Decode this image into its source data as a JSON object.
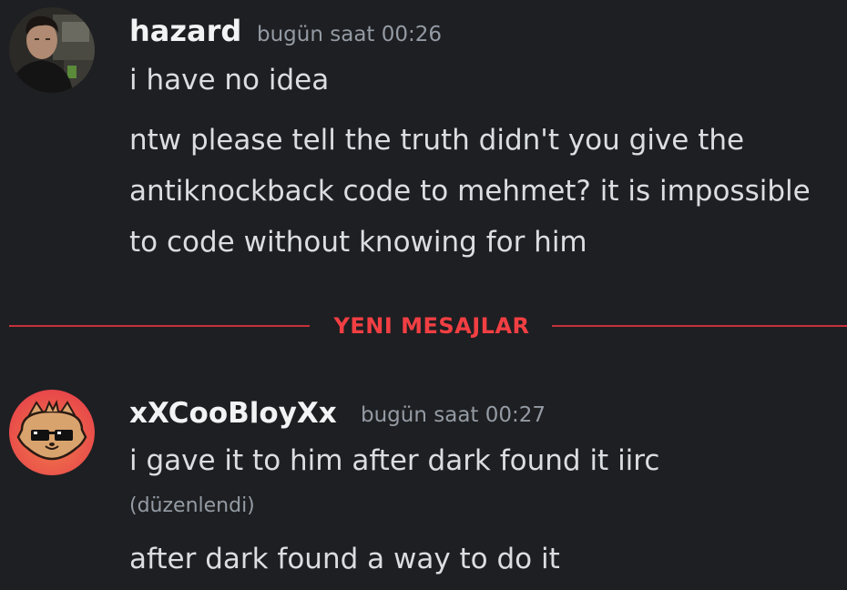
{
  "messages": [
    {
      "username": "hazard",
      "timestamp": "bugün saat 00:26",
      "lines": [
        "i have no idea",
        "ntw please tell the truth didn't you give the antiknockback code to mehmet?  it is impossible to code without knowing for him"
      ]
    },
    {
      "username": "xXCooBloyXx",
      "timestamp": "bugün saat 00:27",
      "lines": [
        "i gave it to him after dark found it iirc",
        "after dark found a way to do it"
      ],
      "edited_label": "(düzenlendi)"
    }
  ],
  "divider": {
    "label": "YENI MESAJLAR",
    "color": "#f23f43"
  },
  "colors": {
    "background": "#1e1f22",
    "text": "#dbdee1",
    "muted": "#949ba4",
    "username": "#f2f3f5"
  }
}
